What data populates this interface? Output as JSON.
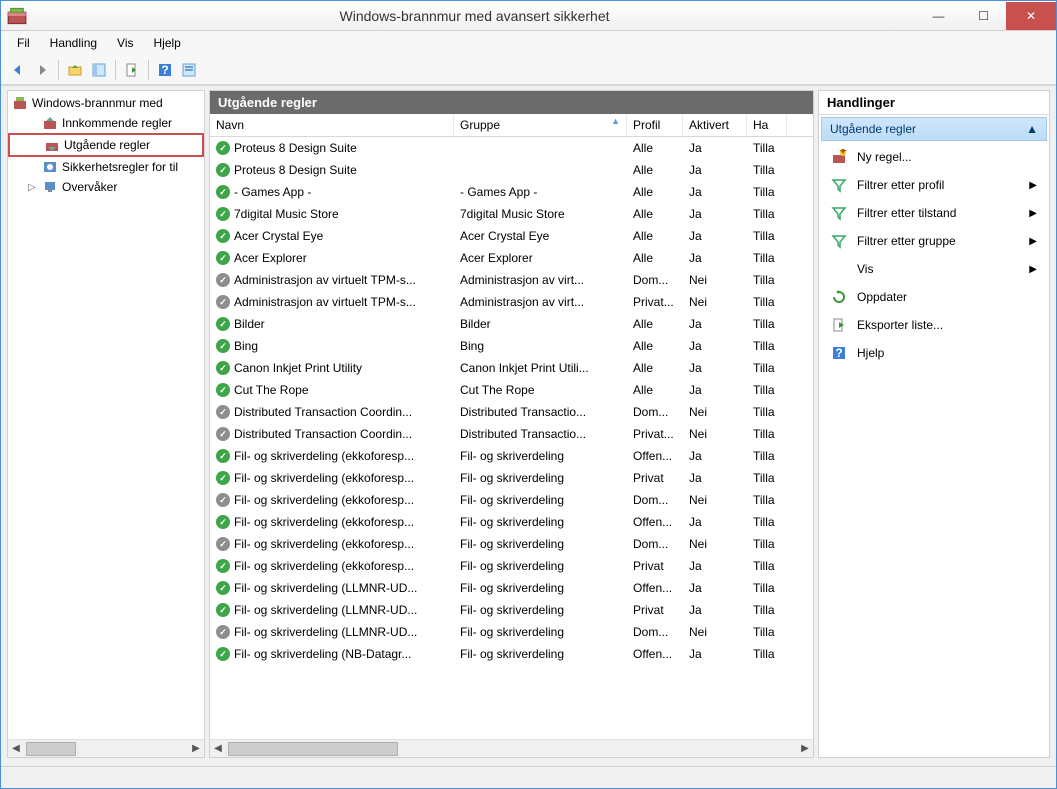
{
  "window": {
    "title": "Windows-brannmur med avansert sikkerhet",
    "minimize": "—",
    "maximize": "☐",
    "close": "✕"
  },
  "menu": {
    "fil": "Fil",
    "handling": "Handling",
    "vis": "Vis",
    "hjelp": "Hjelp"
  },
  "tree": {
    "root": "Windows-brannmur med",
    "items": [
      {
        "label": "Innkommende regler",
        "selected": false
      },
      {
        "label": "Utgående regler",
        "selected": true
      },
      {
        "label": "Sikkerhetsregler for til",
        "selected": false
      },
      {
        "label": "Overvåker",
        "selected": false,
        "expandable": true
      }
    ]
  },
  "main": {
    "header": "Utgående regler",
    "columns": {
      "name": "Navn",
      "group": "Gruppe",
      "profile": "Profil",
      "active": "Aktivert",
      "action": "Ha"
    },
    "rows": [
      {
        "s": "green",
        "name": "Proteus 8 Design Suite",
        "group": "",
        "profile": "Alle",
        "active": "Ja",
        "action": "Tilla"
      },
      {
        "s": "green",
        "name": "Proteus 8 Design Suite",
        "group": "",
        "profile": "Alle",
        "active": "Ja",
        "action": "Tilla"
      },
      {
        "s": "green",
        "name": "- Games App -",
        "group": "- Games App -",
        "profile": "Alle",
        "active": "Ja",
        "action": "Tilla"
      },
      {
        "s": "green",
        "name": "7digital Music Store",
        "group": "7digital Music Store",
        "profile": "Alle",
        "active": "Ja",
        "action": "Tilla"
      },
      {
        "s": "green",
        "name": "Acer Crystal Eye",
        "group": "Acer Crystal Eye",
        "profile": "Alle",
        "active": "Ja",
        "action": "Tilla"
      },
      {
        "s": "green",
        "name": "Acer Explorer",
        "group": "Acer Explorer",
        "profile": "Alle",
        "active": "Ja",
        "action": "Tilla"
      },
      {
        "s": "gray",
        "name": "Administrasjon av virtuelt TPM-s...",
        "group": "Administrasjon av virt...",
        "profile": "Dom...",
        "active": "Nei",
        "action": "Tilla"
      },
      {
        "s": "gray",
        "name": "Administrasjon av virtuelt TPM-s...",
        "group": "Administrasjon av virt...",
        "profile": "Privat...",
        "active": "Nei",
        "action": "Tilla"
      },
      {
        "s": "green",
        "name": "Bilder",
        "group": "Bilder",
        "profile": "Alle",
        "active": "Ja",
        "action": "Tilla"
      },
      {
        "s": "green",
        "name": "Bing",
        "group": "Bing",
        "profile": "Alle",
        "active": "Ja",
        "action": "Tilla"
      },
      {
        "s": "green",
        "name": "Canon Inkjet Print Utility",
        "group": "Canon Inkjet Print Utili...",
        "profile": "Alle",
        "active": "Ja",
        "action": "Tilla"
      },
      {
        "s": "green",
        "name": "Cut The Rope",
        "group": "Cut The Rope",
        "profile": "Alle",
        "active": "Ja",
        "action": "Tilla"
      },
      {
        "s": "gray",
        "name": "Distributed Transaction Coordin...",
        "group": "Distributed Transactio...",
        "profile": "Dom...",
        "active": "Nei",
        "action": "Tilla"
      },
      {
        "s": "gray",
        "name": "Distributed Transaction Coordin...",
        "group": "Distributed Transactio...",
        "profile": "Privat...",
        "active": "Nei",
        "action": "Tilla"
      },
      {
        "s": "green",
        "name": "Fil- og skriverdeling (ekkoforesp...",
        "group": "Fil- og skriverdeling",
        "profile": "Offen...",
        "active": "Ja",
        "action": "Tilla"
      },
      {
        "s": "green",
        "name": "Fil- og skriverdeling (ekkoforesp...",
        "group": "Fil- og skriverdeling",
        "profile": "Privat",
        "active": "Ja",
        "action": "Tilla"
      },
      {
        "s": "gray",
        "name": "Fil- og skriverdeling (ekkoforesp...",
        "group": "Fil- og skriverdeling",
        "profile": "Dom...",
        "active": "Nei",
        "action": "Tilla"
      },
      {
        "s": "green",
        "name": "Fil- og skriverdeling (ekkoforesp...",
        "group": "Fil- og skriverdeling",
        "profile": "Offen...",
        "active": "Ja",
        "action": "Tilla"
      },
      {
        "s": "gray",
        "name": "Fil- og skriverdeling (ekkoforesp...",
        "group": "Fil- og skriverdeling",
        "profile": "Dom...",
        "active": "Nei",
        "action": "Tilla"
      },
      {
        "s": "green",
        "name": "Fil- og skriverdeling (ekkoforesp...",
        "group": "Fil- og skriverdeling",
        "profile": "Privat",
        "active": "Ja",
        "action": "Tilla"
      },
      {
        "s": "green",
        "name": "Fil- og skriverdeling (LLMNR-UD...",
        "group": "Fil- og skriverdeling",
        "profile": "Offen...",
        "active": "Ja",
        "action": "Tilla"
      },
      {
        "s": "green",
        "name": "Fil- og skriverdeling (LLMNR-UD...",
        "group": "Fil- og skriverdeling",
        "profile": "Privat",
        "active": "Ja",
        "action": "Tilla"
      },
      {
        "s": "gray",
        "name": "Fil- og skriverdeling (LLMNR-UD...",
        "group": "Fil- og skriverdeling",
        "profile": "Dom...",
        "active": "Nei",
        "action": "Tilla"
      },
      {
        "s": "green",
        "name": "Fil- og skriverdeling (NB-Datagr...",
        "group": "Fil- og skriverdeling",
        "profile": "Offen...",
        "active": "Ja",
        "action": "Tilla"
      }
    ]
  },
  "actions": {
    "header": "Handlinger",
    "section": "Utgående regler",
    "items": [
      {
        "icon": "new-rule-icon",
        "label": "Ny regel...",
        "sub": false
      },
      {
        "icon": "filter-icon",
        "label": "Filtrer etter profil",
        "sub": true
      },
      {
        "icon": "filter-icon",
        "label": "Filtrer etter tilstand",
        "sub": true
      },
      {
        "icon": "filter-icon",
        "label": "Filtrer etter gruppe",
        "sub": true
      },
      {
        "icon": "",
        "label": "Vis",
        "sub": true
      },
      {
        "icon": "refresh-icon",
        "label": "Oppdater",
        "sub": false
      },
      {
        "icon": "export-icon",
        "label": "Eksporter liste...",
        "sub": false
      },
      {
        "icon": "help-icon",
        "label": "Hjelp",
        "sub": false
      }
    ]
  }
}
